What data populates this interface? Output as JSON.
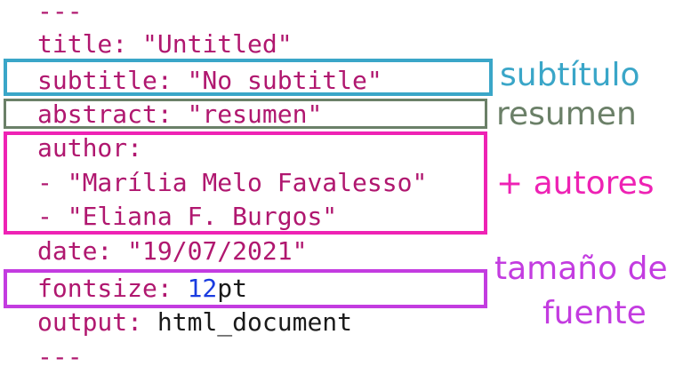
{
  "yaml": {
    "open_delim": "---",
    "title_key": "title:",
    "title_val": "\"Untitled\"",
    "subtitle_key": "subtitle:",
    "subtitle_val": "\"No subtitle\"",
    "abstract_key": "abstract:",
    "abstract_val": "\"resumen\"",
    "author_key": "author:",
    "author_1": "\"Marília Melo Favalesso\"",
    "author_2": "\"Eliana F. Burgos\"",
    "dash": "- ",
    "date_key": "date:",
    "date_val": "\"19/07/2021\"",
    "fontsize_key": "fontsize:",
    "fontsize_num": "12",
    "fontsize_unit": "pt",
    "output_key": "output:",
    "output_val": "html_document",
    "close_delim": "---"
  },
  "annotations": {
    "subtitle": "subtítulo",
    "abstract": "resumen",
    "authors": "+ autores",
    "fontsize_1": "tamaño de",
    "fontsize_2": "fuente"
  },
  "colors": {
    "yaml_text": "#b0176f",
    "number": "#1a3ce0",
    "subtitle_box": "#3aa6c8",
    "abstract_box": "#6b8068",
    "authors_box": "#ee22b4",
    "fontsize_box": "#c33ce0"
  }
}
